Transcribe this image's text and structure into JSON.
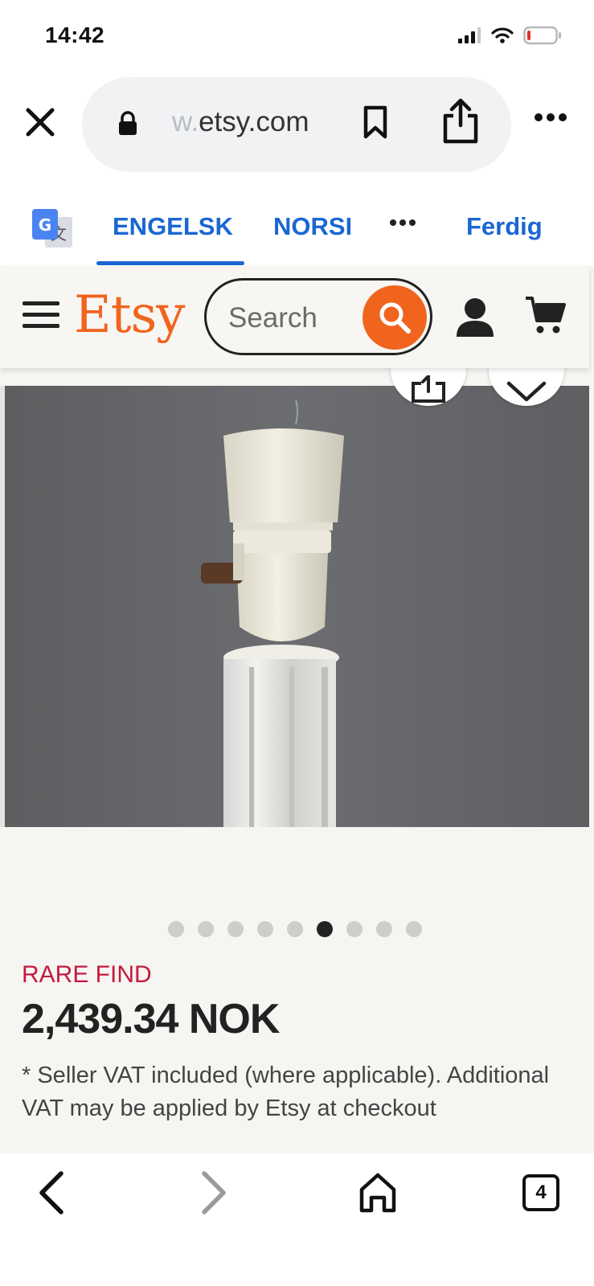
{
  "status_bar": {
    "time": "14:42"
  },
  "browser": {
    "url_faded": "w.",
    "url_main": "etsy.com"
  },
  "translate_bar": {
    "tabs": [
      "ENGELSK",
      "NORSK"
    ],
    "done_label": "Ferdig"
  },
  "etsy_header": {
    "logo": "Etsy",
    "search_placeholder": "Search"
  },
  "carousel": {
    "total": 9,
    "active_index": 5
  },
  "product": {
    "badge": "RARE FIND",
    "price": "2,439.34 NOK",
    "vat_note": "* Seller VAT included (where applicable). Additional VAT may be applied by Etsy at checkout"
  },
  "bottom_toolbar": {
    "tab_count": "4"
  },
  "colors": {
    "etsy_orange": "#f1641e",
    "translate_blue": "#1a67d2",
    "rare_find_red": "#c41b3d"
  },
  "icons": [
    "close-icon",
    "lock-icon",
    "bookmark-icon",
    "share-icon",
    "more-icon",
    "translate-icon",
    "hamburger-icon",
    "search-icon",
    "account-icon",
    "cart-icon",
    "heart-icon",
    "back-icon",
    "forward-icon",
    "home-icon",
    "tabs-icon"
  ]
}
